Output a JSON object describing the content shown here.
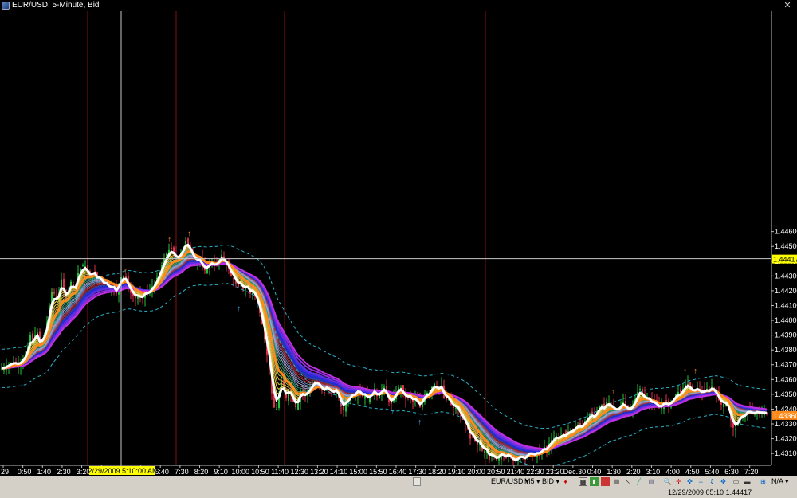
{
  "window": {
    "title": "EUR/USD, 5-Minute, Bid",
    "close_icon": "close-icon"
  },
  "colors": {
    "background": "#000000",
    "up_candle": "#22c33a",
    "down_candle": "#e0304a",
    "crosshair": "#c8c8c8",
    "day_separator": "#8a1010",
    "ma_fast": "#ffffff",
    "ma_slow": "#ff8a1a",
    "envelope": "#2ab0c8",
    "current_price_bg": "#ff8a1a",
    "crosshair_price_bg": "#ffff00"
  },
  "chart_data": {
    "type": "candlestick",
    "symbol": "EUR/USD",
    "timeframe": "5-Minute",
    "side": "Bid",
    "ylim": [
      1.4302,
      1.4609
    ],
    "y_ticks": [
      "1.44600",
      "1.44500",
      "1.44400",
      "1.44300",
      "1.44200",
      "1.44100",
      "1.44000",
      "1.43900",
      "1.43800",
      "1.43700",
      "1.43600",
      "1.43500",
      "1.43400",
      "1.43300",
      "1.43200",
      "1.43100"
    ],
    "x_ticks": [
      "29",
      "0:50",
      "1:40",
      "2:30",
      "3:20",
      "4:10",
      "5:00",
      "5:50",
      "6:40",
      "7:30",
      "8:20",
      "9:10",
      "10:00",
      "10:50",
      "11:40",
      "12:30",
      "13:20",
      "14:10",
      "15:00",
      "15:50",
      "16:40",
      "17:30",
      "18:20",
      "19:10",
      "20:00",
      "20:50",
      "21:40",
      "22:30",
      "23:20",
      "Dec.30",
      "0:40",
      "1:30",
      "2:20",
      "3:10",
      "4:00",
      "4:50",
      "5:40",
      "6:30",
      "7:20"
    ],
    "crosshair": {
      "time_label": "12/29/2009 5:10:00 AM",
      "price_label": "1.44417",
      "price": 1.44417
    },
    "current_price": {
      "label": "1.43360",
      "price": 1.4336
    },
    "path": [
      [
        0,
        1.4367
      ],
      [
        8,
        1.4369
      ],
      [
        16,
        1.4372
      ],
      [
        24,
        1.437
      ],
      [
        30,
        1.4375
      ],
      [
        34,
        1.438
      ],
      [
        38,
        1.439
      ],
      [
        42,
        1.4385
      ],
      [
        46,
        1.4395
      ],
      [
        50,
        1.4382
      ],
      [
        54,
        1.4388
      ],
      [
        58,
        1.4395
      ],
      [
        62,
        1.441
      ],
      [
        66,
        1.4422
      ],
      [
        70,
        1.4414
      ],
      [
        74,
        1.4418
      ],
      [
        78,
        1.443
      ],
      [
        82,
        1.4412
      ],
      [
        86,
        1.442
      ],
      [
        90,
        1.4428
      ],
      [
        94,
        1.4418
      ],
      [
        98,
        1.4432
      ],
      [
        102,
        1.4436
      ],
      [
        106,
        1.4438
      ],
      [
        110,
        1.4432
      ],
      [
        114,
        1.4428
      ],
      [
        118,
        1.4435
      ],
      [
        122,
        1.4426
      ],
      [
        126,
        1.443
      ],
      [
        130,
        1.4422
      ],
      [
        134,
        1.4425
      ],
      [
        138,
        1.442
      ],
      [
        142,
        1.4424
      ],
      [
        146,
        1.4418
      ],
      [
        150,
        1.4427
      ],
      [
        154,
        1.4431
      ],
      [
        158,
        1.4428
      ],
      [
        162,
        1.442
      ],
      [
        166,
        1.4417
      ],
      [
        170,
        1.4415
      ],
      [
        174,
        1.4417
      ],
      [
        178,
        1.4414
      ],
      [
        182,
        1.442
      ],
      [
        186,
        1.4418
      ],
      [
        190,
        1.4422
      ],
      [
        194,
        1.4425
      ],
      [
        198,
        1.443
      ],
      [
        202,
        1.4436
      ],
      [
        206,
        1.4442
      ],
      [
        210,
        1.4446
      ],
      [
        214,
        1.4449
      ],
      [
        218,
        1.4445
      ],
      [
        222,
        1.444
      ],
      [
        226,
        1.4444
      ],
      [
        230,
        1.445
      ],
      [
        234,
        1.4455
      ],
      [
        238,
        1.4448
      ],
      [
        242,
        1.4442
      ],
      [
        246,
        1.4438
      ],
      [
        250,
        1.4442
      ],
      [
        254,
        1.4436
      ],
      [
        258,
        1.4433
      ],
      [
        262,
        1.4438
      ],
      [
        266,
        1.444
      ],
      [
        270,
        1.4436
      ],
      [
        274,
        1.444
      ],
      [
        278,
        1.4444
      ],
      [
        282,
        1.444
      ],
      [
        286,
        1.4436
      ],
      [
        290,
        1.443
      ],
      [
        294,
        1.4428
      ],
      [
        298,
        1.4422
      ],
      [
        302,
        1.4425
      ],
      [
        306,
        1.442
      ],
      [
        310,
        1.4424
      ],
      [
        314,
        1.4418
      ],
      [
        318,
        1.442
      ],
      [
        322,
        1.4414
      ],
      [
        326,
        1.4405
      ],
      [
        330,
        1.4395
      ],
      [
        334,
        1.438
      ],
      [
        338,
        1.4368
      ],
      [
        342,
        1.4345
      ],
      [
        346,
        1.4337
      ],
      [
        350,
        1.435
      ],
      [
        354,
        1.4362
      ],
      [
        358,
        1.4346
      ],
      [
        362,
        1.4352
      ],
      [
        366,
        1.435
      ],
      [
        370,
        1.434
      ],
      [
        374,
        1.4345
      ],
      [
        378,
        1.4355
      ],
      [
        382,
        1.4348
      ],
      [
        386,
        1.4352
      ],
      [
        390,
        1.4355
      ],
      [
        394,
        1.436
      ],
      [
        398,
        1.4358
      ],
      [
        402,
        1.4355
      ],
      [
        406,
        1.435
      ],
      [
        410,
        1.4356
      ],
      [
        414,
        1.4352
      ],
      [
        418,
        1.435
      ],
      [
        422,
        1.4354
      ],
      [
        426,
        1.4346
      ],
      [
        430,
        1.4338
      ],
      [
        434,
        1.4345
      ],
      [
        438,
        1.4348
      ],
      [
        442,
        1.4352
      ],
      [
        446,
        1.435
      ],
      [
        450,
        1.4355
      ],
      [
        454,
        1.4348
      ],
      [
        458,
        1.435
      ],
      [
        462,
        1.4346
      ],
      [
        466,
        1.435
      ],
      [
        470,
        1.4354
      ],
      [
        474,
        1.4347
      ],
      [
        478,
        1.4352
      ],
      [
        482,
        1.4355
      ],
      [
        486,
        1.4348
      ],
      [
        490,
        1.4342
      ],
      [
        494,
        1.4348
      ],
      [
        498,
        1.4353
      ],
      [
        502,
        1.4356
      ],
      [
        506,
        1.435
      ],
      [
        510,
        1.4346
      ],
      [
        514,
        1.435
      ],
      [
        518,
        1.4345
      ],
      [
        522,
        1.4348
      ],
      [
        526,
        1.434
      ],
      [
        530,
        1.4346
      ],
      [
        534,
        1.4352
      ],
      [
        538,
        1.435
      ],
      [
        542,
        1.4355
      ],
      [
        546,
        1.4358
      ],
      [
        550,
        1.4352
      ],
      [
        554,
        1.4356
      ],
      [
        558,
        1.4345
      ],
      [
        562,
        1.4348
      ],
      [
        566,
        1.4343
      ],
      [
        570,
        1.434
      ],
      [
        574,
        1.4342
      ],
      [
        578,
        1.4335
      ],
      [
        582,
        1.4332
      ],
      [
        586,
        1.4328
      ],
      [
        590,
        1.432
      ],
      [
        594,
        1.4322
      ],
      [
        598,
        1.4315
      ],
      [
        602,
        1.4318
      ],
      [
        606,
        1.431
      ],
      [
        610,
        1.4314
      ],
      [
        614,
        1.4306
      ],
      [
        618,
        1.431
      ],
      [
        622,
        1.4305
      ],
      [
        626,
        1.4308
      ],
      [
        630,
        1.4312
      ],
      [
        634,
        1.4306
      ],
      [
        638,
        1.431
      ],
      [
        642,
        1.4306
      ],
      [
        646,
        1.4304
      ],
      [
        650,
        1.4307
      ],
      [
        654,
        1.431
      ],
      [
        658,
        1.4305
      ],
      [
        662,
        1.431
      ],
      [
        666,
        1.4312
      ],
      [
        670,
        1.4308
      ],
      [
        674,
        1.4311
      ],
      [
        678,
        1.431
      ],
      [
        682,
        1.4315
      ],
      [
        686,
        1.4313
      ],
      [
        690,
        1.4318
      ],
      [
        694,
        1.432
      ],
      [
        698,
        1.4322
      ],
      [
        702,
        1.432
      ],
      [
        706,
        1.4324
      ],
      [
        710,
        1.4322
      ],
      [
        714,
        1.4326
      ],
      [
        718,
        1.4325
      ],
      [
        722,
        1.4328
      ],
      [
        726,
        1.433
      ],
      [
        730,
        1.4327
      ],
      [
        734,
        1.4332
      ],
      [
        738,
        1.4335
      ],
      [
        742,
        1.4338
      ],
      [
        746,
        1.4334
      ],
      [
        750,
        1.434
      ],
      [
        754,
        1.4344
      ],
      [
        758,
        1.434
      ],
      [
        762,
        1.4346
      ],
      [
        766,
        1.4342
      ],
      [
        770,
        1.434
      ],
      [
        774,
        1.4338
      ],
      [
        778,
        1.4342
      ],
      [
        782,
        1.4345
      ],
      [
        786,
        1.434
      ],
      [
        790,
        1.4338
      ],
      [
        794,
        1.4343
      ],
      [
        798,
        1.4348
      ],
      [
        802,
        1.4355
      ],
      [
        806,
        1.435
      ],
      [
        810,
        1.4345
      ],
      [
        814,
        1.4348
      ],
      [
        818,
        1.4343
      ],
      [
        822,
        1.4345
      ],
      [
        826,
        1.434
      ],
      [
        830,
        1.4342
      ],
      [
        834,
        1.4346
      ],
      [
        838,
        1.4342
      ],
      [
        842,
        1.4345
      ],
      [
        846,
        1.4348
      ],
      [
        850,
        1.4352
      ],
      [
        854,
        1.435
      ],
      [
        858,
        1.4355
      ],
      [
        862,
        1.4358
      ],
      [
        866,
        1.4354
      ],
      [
        870,
        1.435
      ],
      [
        874,
        1.4355
      ],
      [
        878,
        1.4352
      ],
      [
        882,
        1.435
      ],
      [
        886,
        1.4354
      ],
      [
        890,
        1.4352
      ],
      [
        894,
        1.4356
      ],
      [
        898,
        1.435
      ],
      [
        902,
        1.4346
      ],
      [
        906,
        1.4342
      ],
      [
        910,
        1.4345
      ],
      [
        914,
        1.434
      ],
      [
        918,
        1.433
      ],
      [
        922,
        1.4325
      ],
      [
        926,
        1.4332
      ],
      [
        930,
        1.4338
      ],
      [
        934,
        1.4335
      ],
      [
        938,
        1.434
      ],
      [
        942,
        1.4338
      ],
      [
        946,
        1.4336
      ],
      [
        950,
        1.4339
      ],
      [
        954,
        1.4337
      ],
      [
        958,
        1.4338
      ],
      [
        964,
        1.4336
      ]
    ]
  },
  "toolbar": {
    "symbol_select": "EUR/USD",
    "timeframe_select": "M5",
    "side_select": "BID",
    "zoom_select": "N/A"
  },
  "status": {
    "text": "12/29/2009 05:10  1.44417"
  }
}
